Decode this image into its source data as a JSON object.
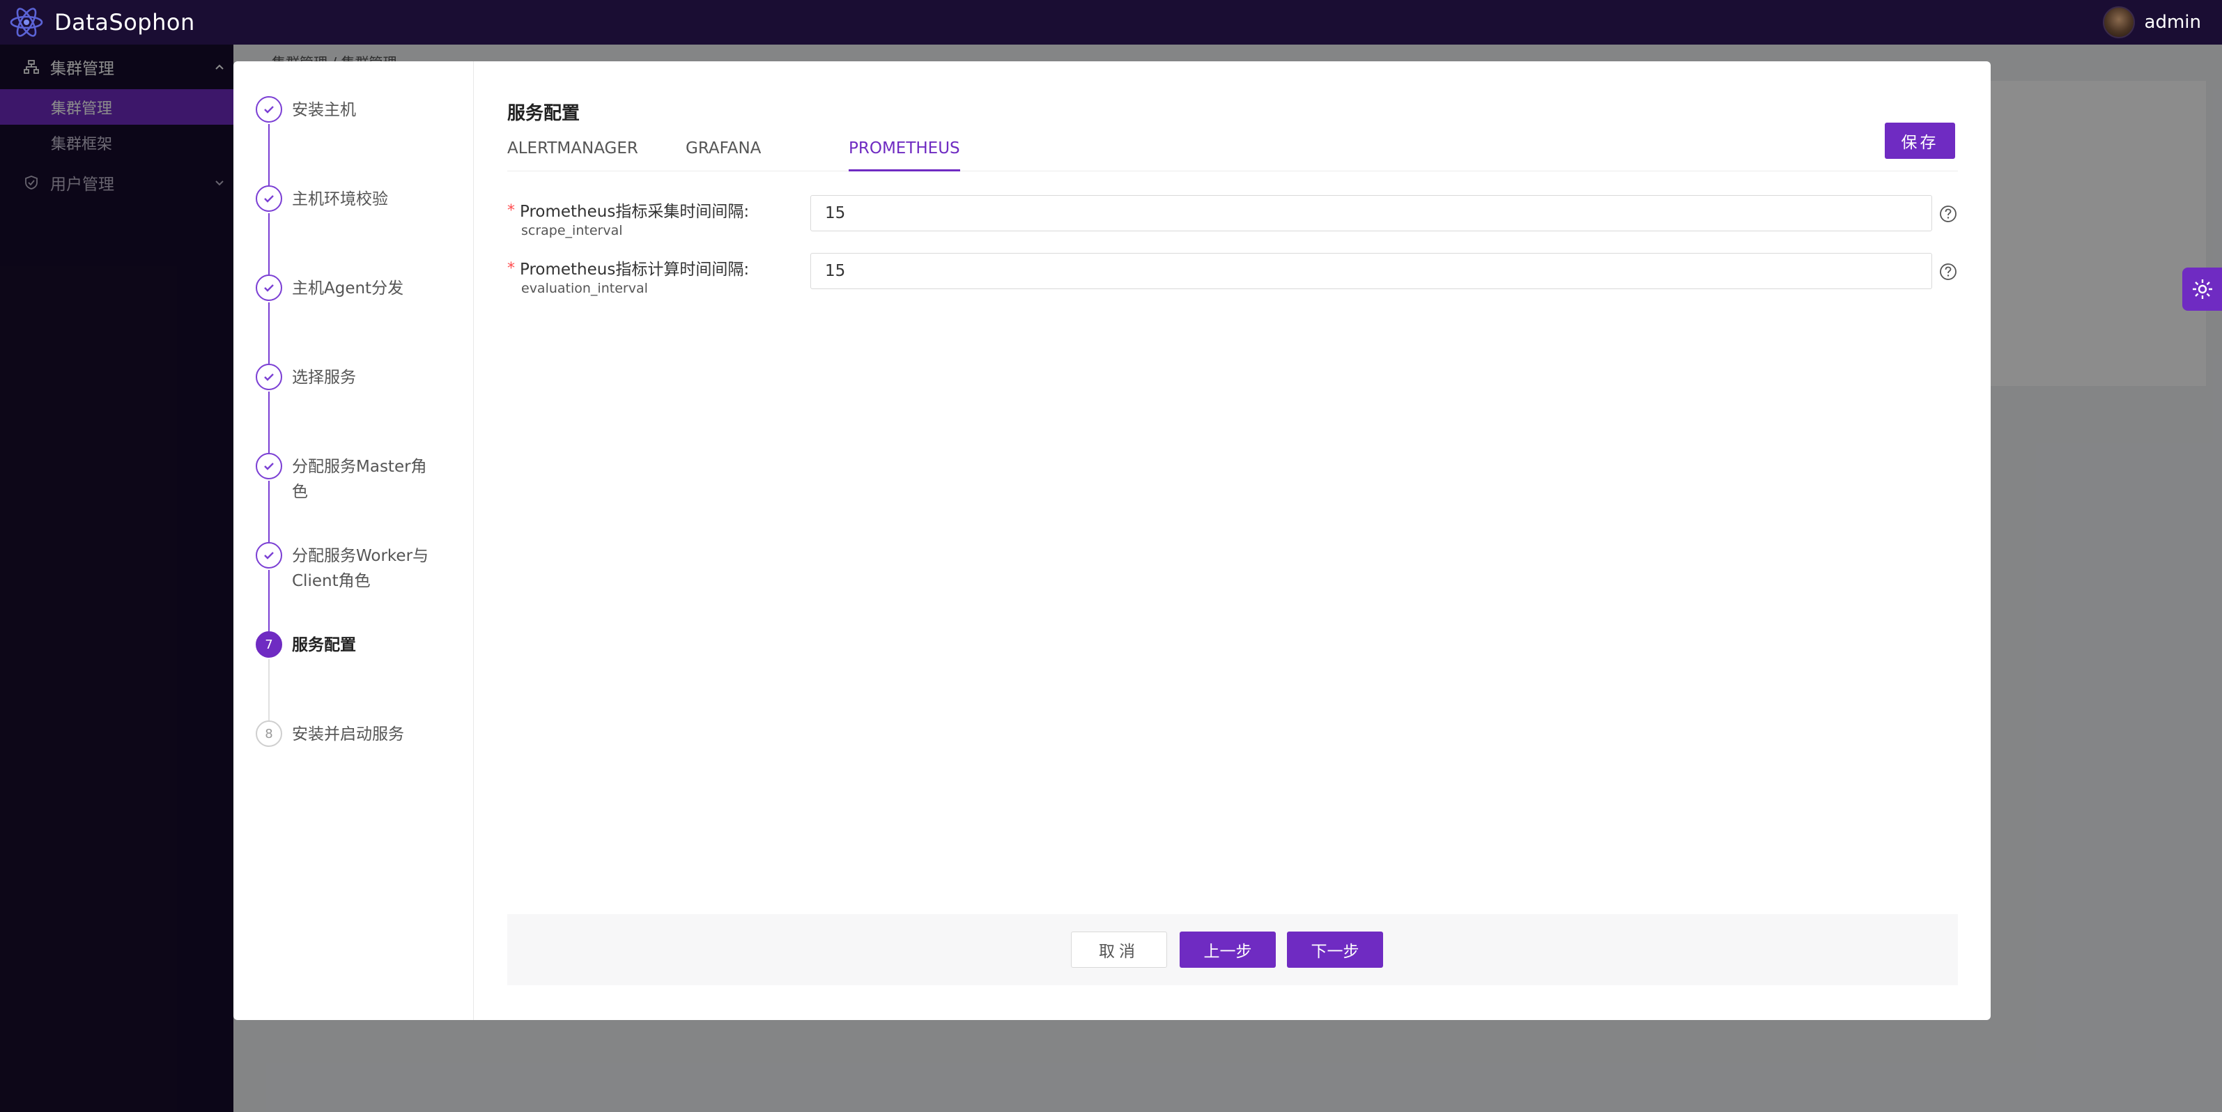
{
  "app": {
    "name": "DataSophon"
  },
  "user": {
    "name": "admin"
  },
  "sidebar": {
    "groups": [
      {
        "label": "集群管理",
        "items": [
          {
            "label": "集群管理",
            "active": true
          },
          {
            "label": "集群框架",
            "active": false
          }
        ]
      },
      {
        "label": "用户管理",
        "items": []
      }
    ]
  },
  "breadcrumb": "集群管理 / 集群管理",
  "steps": [
    {
      "label": "安装主机",
      "state": "done"
    },
    {
      "label": "主机环境校验",
      "state": "done"
    },
    {
      "label": "主机Agent分发",
      "state": "done"
    },
    {
      "label": "选择服务",
      "state": "done"
    },
    {
      "label": "分配服务Master角色",
      "state": "done"
    },
    {
      "label": "分配服务Worker与Client角色",
      "state": "done"
    },
    {
      "label": "服务配置",
      "state": "current",
      "number": "7"
    },
    {
      "label": "安装并启动服务",
      "state": "pending",
      "number": "8"
    }
  ],
  "form": {
    "title": "服务配置",
    "tabs": [
      {
        "label": "ALERTMANAGER"
      },
      {
        "label": "GRAFANA"
      },
      {
        "label": "PROMETHEUS",
        "active": true
      }
    ],
    "save_label": "保存",
    "fields": [
      {
        "label": "Prometheus指标采集时间间隔:",
        "key": "scrape_interval",
        "value": "15",
        "required": true
      },
      {
        "label": "Prometheus指标计算时间间隔:",
        "key": "evaluation_interval",
        "value": "15",
        "required": true
      }
    ]
  },
  "footer": {
    "cancel": "取消",
    "prev": "上一步",
    "next": "下一步"
  },
  "colors": {
    "primary": "#6f2bc2",
    "header": "#1a0d33",
    "sidebar": "#170c2c",
    "required": "#ff4d4f"
  },
  "icons": {
    "logo": "atom-logo-icon",
    "cluster": "cluster-icon",
    "user_mgmt": "shield-icon",
    "settings": "gear-icon",
    "help": "question-circle-icon",
    "check": "check-icon"
  }
}
